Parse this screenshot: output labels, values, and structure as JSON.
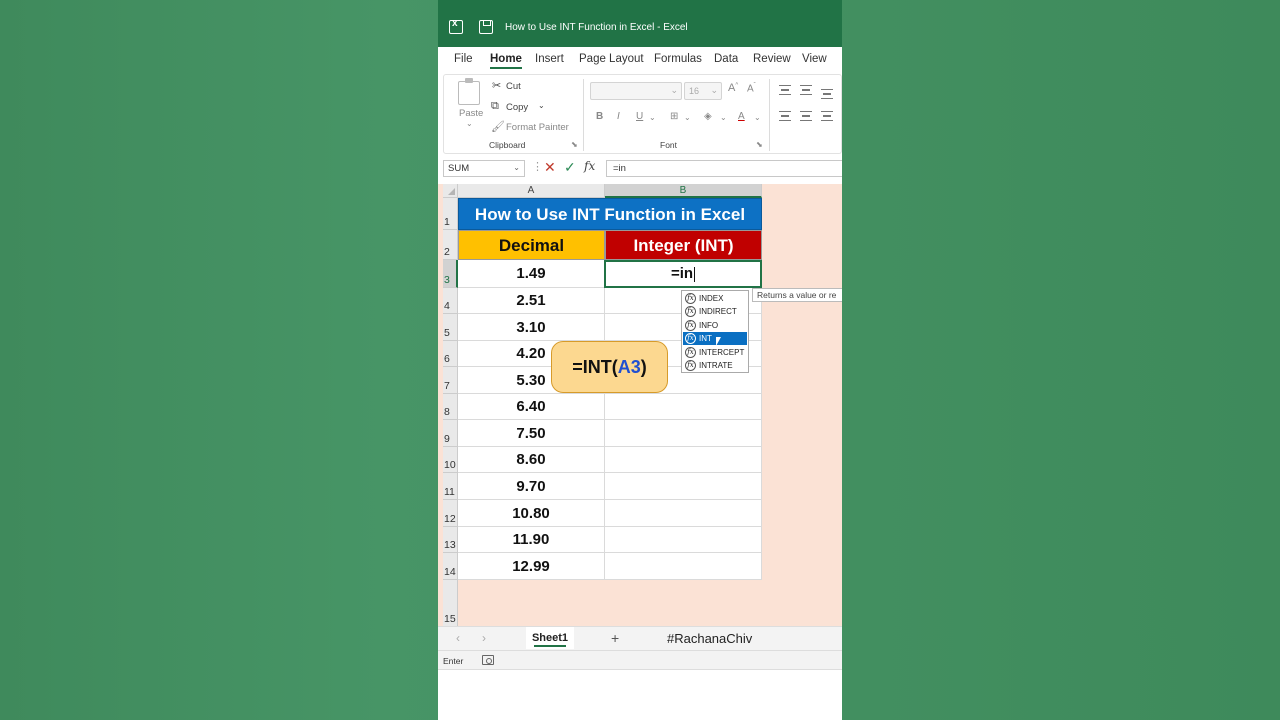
{
  "window": {
    "title": "How to Use INT Function in Excel  -  Excel"
  },
  "tabs": [
    "File",
    "Home",
    "Insert",
    "Page Layout",
    "Formulas",
    "Data",
    "Review",
    "View"
  ],
  "ribbon": {
    "paste_label": "Paste",
    "cut_label": "Cut",
    "copy_label": "Copy",
    "format_painter_label": "Format Painter",
    "clipboard_label": "Clipboard",
    "font_size": "16",
    "font_label": "Font",
    "bold": "B",
    "italic": "I",
    "underline": "U"
  },
  "formula_bar": {
    "name_box": "SUM",
    "fx": "fx",
    "formula": "=in"
  },
  "columns": [
    "A",
    "B"
  ],
  "rows": [
    "1",
    "2",
    "3",
    "4",
    "5",
    "6",
    "7",
    "8",
    "9",
    "10",
    "11",
    "12",
    "13",
    "14",
    "15"
  ],
  "sheet": {
    "title": "How to Use INT Function in Excel",
    "header_decimal": "Decimal",
    "header_integer": "Integer (INT)",
    "decimals": [
      "1.49",
      "2.51",
      "3.10",
      "4.20",
      "5.30",
      "6.40",
      "7.50",
      "8.60",
      "9.70",
      "10.80",
      "11.90",
      "12.99"
    ],
    "active_cell_text": "=in"
  },
  "autocomplete": {
    "items": [
      "INDEX",
      "INDIRECT",
      "INFO",
      "INT",
      "INTERCEPT",
      "INTRATE"
    ],
    "selected": "INT",
    "tooltip": "Returns a value or re"
  },
  "callout": {
    "prefix": "=INT(",
    "ref": "A3",
    "suffix": ")"
  },
  "sheet_tabs": {
    "active": "Sheet1",
    "add": "+",
    "watermark": "#RachanaChiv"
  },
  "status": {
    "mode": "Enter"
  },
  "colors": {
    "excel_green": "#217346",
    "title_blue": "#0d71c4",
    "decimal_yellow": "#ffc000",
    "integer_red": "#c00000"
  }
}
